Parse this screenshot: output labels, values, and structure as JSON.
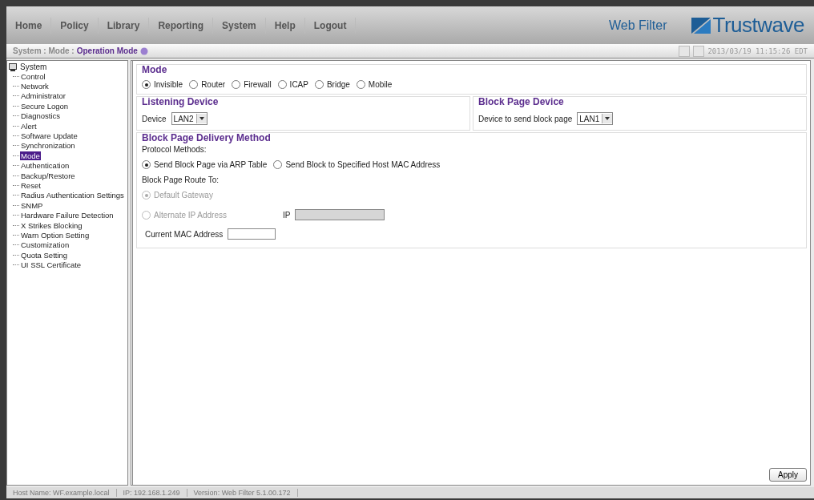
{
  "nav": [
    {
      "label": "Home"
    },
    {
      "label": "Policy"
    },
    {
      "label": "Library"
    },
    {
      "label": "Reporting"
    },
    {
      "label": "System"
    },
    {
      "label": "Help"
    },
    {
      "label": "Logout"
    }
  ],
  "product": "Web Filter",
  "brand": "Trustwave",
  "breadcrumb": {
    "path": "System : Mode :",
    "current": "Operation Mode"
  },
  "timestamp": "2013/03/19 11:15:26 EDT",
  "tree": {
    "label": "System",
    "children": [
      {
        "label": "Control",
        "selected": false
      },
      {
        "label": "Network",
        "selected": false
      },
      {
        "label": "Administrator",
        "selected": false
      },
      {
        "label": "Secure Logon",
        "selected": false
      },
      {
        "label": "Diagnostics",
        "selected": false
      },
      {
        "label": "Alert",
        "selected": false
      },
      {
        "label": "Software Update",
        "selected": false
      },
      {
        "label": "Synchronization",
        "selected": false
      },
      {
        "label": "Mode",
        "selected": true
      },
      {
        "label": "Authentication",
        "selected": false
      },
      {
        "label": "Backup/Restore",
        "selected": false
      },
      {
        "label": "Reset",
        "selected": false
      },
      {
        "label": "Radius Authentication Settings",
        "selected": false
      },
      {
        "label": "SNMP",
        "selected": false
      },
      {
        "label": "Hardware Failure Detection",
        "selected": false
      },
      {
        "label": "X Strikes Blocking",
        "selected": false
      },
      {
        "label": "Warn Option Setting",
        "selected": false
      },
      {
        "label": "Customization",
        "selected": false
      },
      {
        "label": "Quota Setting",
        "selected": false
      },
      {
        "label": "UI SSL Certificate",
        "selected": false
      }
    ]
  },
  "mode": {
    "title": "Mode",
    "options": [
      {
        "label": "Invisible",
        "selected": true
      },
      {
        "label": "Router",
        "selected": false
      },
      {
        "label": "Firewall",
        "selected": false
      },
      {
        "label": "ICAP",
        "selected": false
      },
      {
        "label": "Bridge",
        "selected": false
      },
      {
        "label": "Mobile",
        "selected": false
      }
    ]
  },
  "listening_device": {
    "title": "Listening Device",
    "label": "Device",
    "value": "LAN2"
  },
  "block_page_device": {
    "title": "Block Page Device",
    "label": "Device to send block page",
    "value": "LAN1"
  },
  "delivery": {
    "title": "Block Page Delivery Method",
    "protocol_label": "Protocol Methods:",
    "protocol_options": [
      {
        "label": "Send Block Page via ARP Table",
        "selected": true
      },
      {
        "label": "Send Block to Specified Host MAC Address",
        "selected": false
      }
    ],
    "route_label": "Block Page Route To:",
    "route_options": [
      {
        "label": "Default Gateway",
        "selected": true,
        "disabled": true
      },
      {
        "label": "Alternate IP Address",
        "selected": false,
        "disabled": true
      }
    ],
    "ip": {
      "label": "IP",
      "disabled": true
    },
    "mac_label": "Current MAC Address"
  },
  "apply": "Apply",
  "status_bar": [
    {
      "text": "Host Name: WF.example.local"
    },
    {
      "text": "IP: 192.168.1.249"
    },
    {
      "text": "Version: Web Filter 5.1.00.172"
    }
  ]
}
